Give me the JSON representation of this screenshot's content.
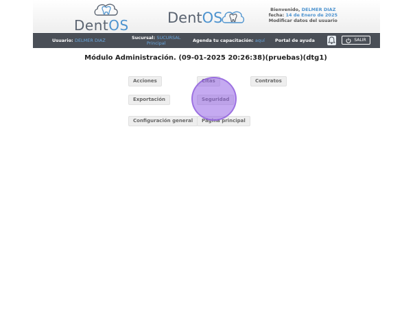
{
  "header": {
    "logo_left": {
      "part1": "Dent",
      "part2": "OS"
    },
    "logo_mid": {
      "part1": "Dent",
      "part2": "OS"
    },
    "welcome": {
      "greeting": "Bienvenido, ",
      "user": "DELMER DIAZ",
      "date_label": "fecha: ",
      "date": "14 de Enero de 2025",
      "modify": "Modificar datos del usuario"
    }
  },
  "userbar": {
    "user_label": "Usuario: ",
    "user_value": "DELMER DIAZ",
    "branch_label": "Sucursal: ",
    "branch_value_1": "SUCURSAL",
    "branch_value_2": "Principal",
    "agenda_label": "Agenda tu capacitación: ",
    "agenda_link": "aquí",
    "help": "Portal de ayuda",
    "logout": "SALIR"
  },
  "main": {
    "title": "Módulo Administración. (09-01-2025 20:26:38)(pruebas)(dtg1)",
    "buttons": {
      "acciones": "Acciones",
      "citas": "Citas",
      "contratos": "Contratos",
      "exportacion": "Exportación",
      "seguridad": "Seguridad",
      "configuracion": "Configuración general",
      "pagina_principal": "Página principal"
    }
  },
  "colors": {
    "accent": "#4d93cf",
    "bar": "#4a4f57",
    "click_indicator": "#9664e6"
  },
  "icons": {
    "logo": "tooth-icon",
    "bell": "bell-icon",
    "logout": "power-icon"
  }
}
